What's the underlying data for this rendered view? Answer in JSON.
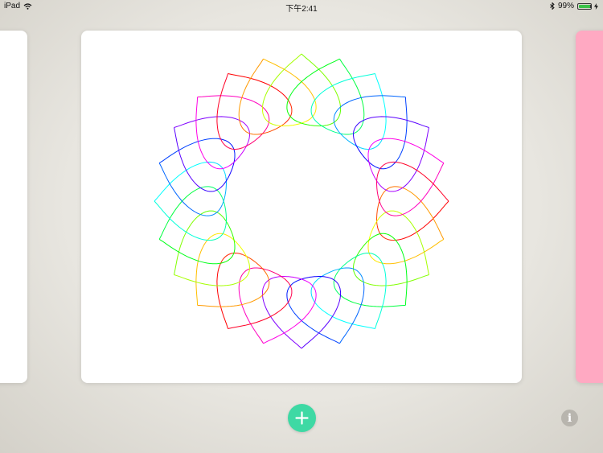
{
  "status_bar": {
    "device": "iPad",
    "time": "下午2:41",
    "battery": "99%",
    "battery_level": 0.99,
    "wifi_icon": "wifi-icon",
    "bluetooth_icon": "bluetooth-icon",
    "charging_icon": "charging-bolt-icon"
  },
  "gallery": {
    "cards": [
      {
        "id": "prev",
        "color": "#ffffff"
      },
      {
        "id": "current",
        "color": "#ffffff",
        "drawing": "spirograph"
      },
      {
        "id": "next",
        "color": "#ffa9c2"
      }
    ]
  },
  "toolbar": {
    "add_icon": "plus-icon",
    "add_color": "#3ed9a4",
    "info_label": "i",
    "info_icon": "info-icon"
  }
}
